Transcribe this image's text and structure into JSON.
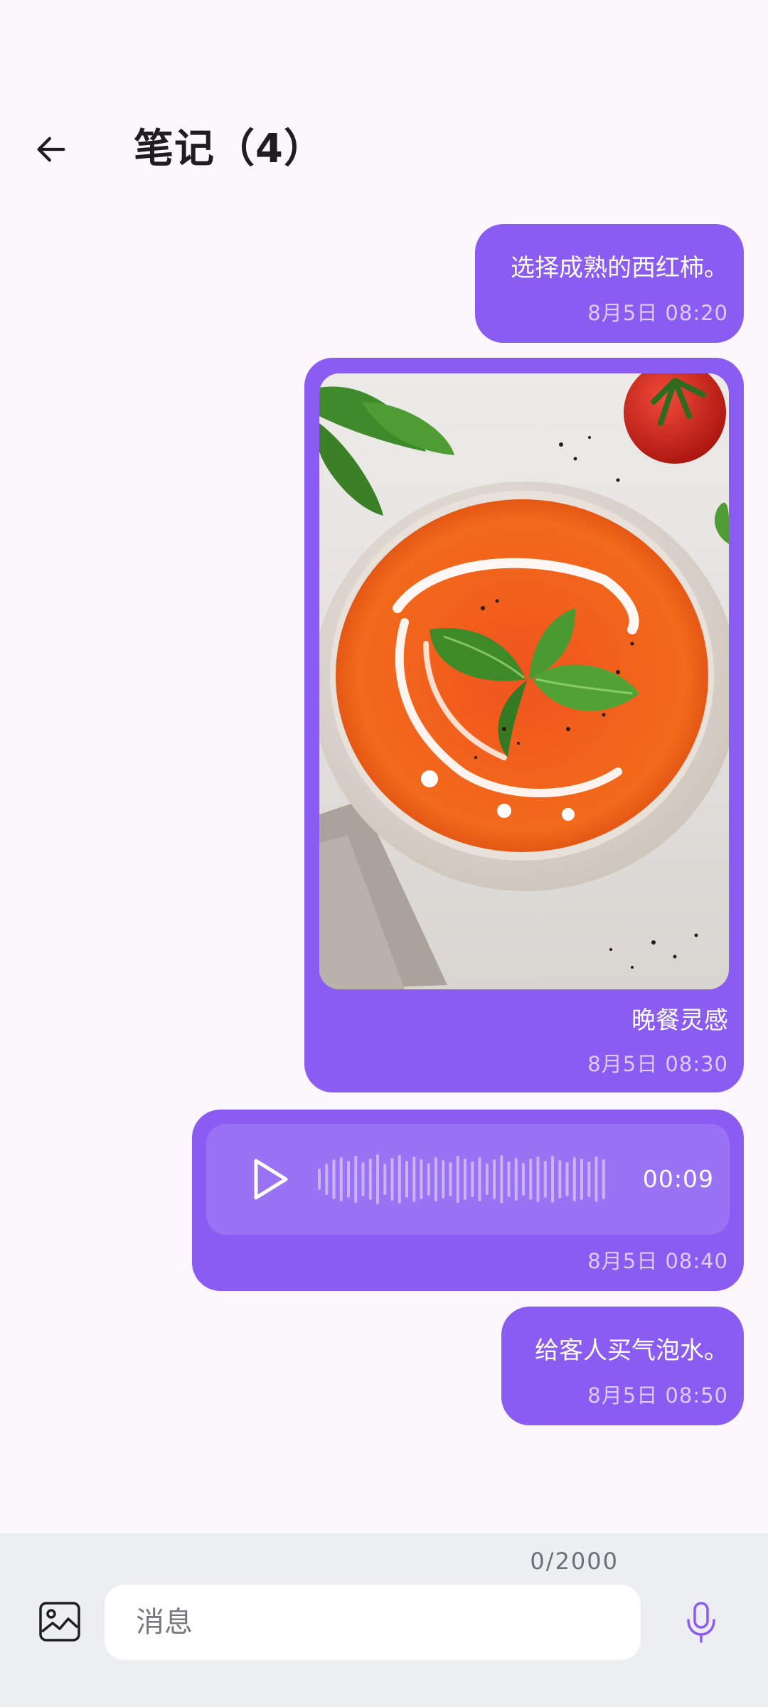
{
  "header": {
    "title": "笔记（4）"
  },
  "messages": [
    {
      "type": "text",
      "text": "选择成熟的西红柿。",
      "time": "8月5日 08:20"
    },
    {
      "type": "image",
      "caption": "晚餐灵感",
      "time": "8月5日 08:30"
    },
    {
      "type": "voice",
      "duration": "00:09",
      "time": "8月5日 08:40"
    },
    {
      "type": "text",
      "text": "给客人买气泡水。",
      "time": "8月5日 08:50"
    }
  ],
  "composer": {
    "counter": "0/2000",
    "placeholder": "消息"
  },
  "colors": {
    "background": "#FCF6FD",
    "bubble": "#8B5CF2",
    "accent_icon": "#8B5CF2",
    "composer_bg": "#ECEEF2"
  },
  "icons": {
    "back": "arrow-left-icon",
    "play": "play-icon",
    "image": "image-icon",
    "mic": "microphone-icon"
  }
}
